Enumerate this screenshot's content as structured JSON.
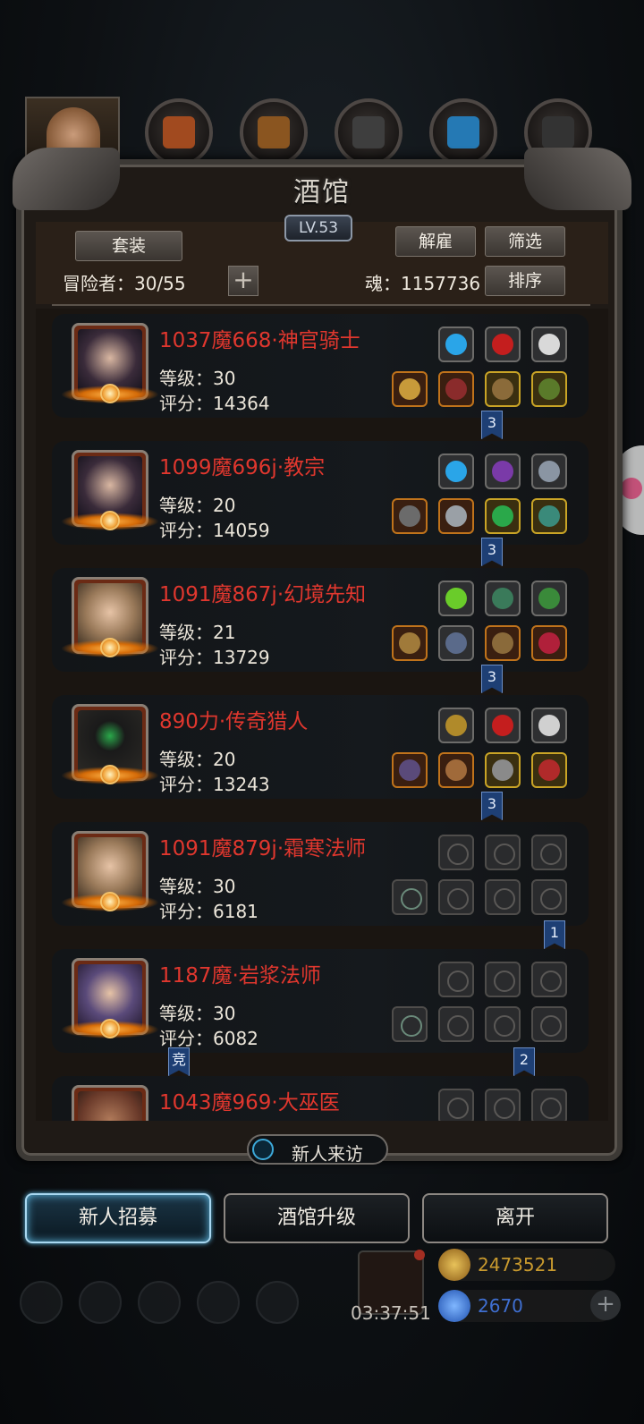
{
  "header": {
    "title": "酒馆",
    "level": "LV.53",
    "buttons": {
      "set": "套装",
      "dismiss": "解雇",
      "filter": "筛选",
      "sort": "排序"
    },
    "adventurers_label": "冒险者：30/55",
    "soul_label": "魂：1157736"
  },
  "adventurers": [
    {
      "name": "1037魔668·神官骑士",
      "level": "等级：30",
      "score": "评分：14364",
      "ribbon": "3"
    },
    {
      "name": "1099魔696j·教宗",
      "level": "等级：20",
      "score": "评分：14059",
      "ribbon": "3"
    },
    {
      "name": "1091魔867j·幻境先知",
      "level": "等级：21",
      "score": "评分：13729",
      "ribbon": "3"
    },
    {
      "name": "890力·传奇猎人",
      "level": "等级：20",
      "score": "评分：13243",
      "ribbon": "3"
    },
    {
      "name": "1091魔879j·霜寒法师",
      "level": "等级：30",
      "score": "评分：6181",
      "ribbon": "1"
    },
    {
      "name": "1187魔·岩浆法师",
      "level": "等级：30",
      "score": "评分：6082",
      "ribbon": "2",
      "tag": "竞"
    },
    {
      "name": "1043魔969·大巫医"
    }
  ],
  "bottom": {
    "visit": "新人来访",
    "recruit": "新人招募",
    "upgrade": "酒馆升级",
    "leave": "离开",
    "timer": "03:37:51",
    "gold": "2473521",
    "gems": "2670"
  },
  "colors": {
    "name_red": "#e0372e",
    "accent_blue": "#5fbbe6",
    "gold_text": "#c99a2e",
    "gem_text": "#3f6fd1"
  }
}
